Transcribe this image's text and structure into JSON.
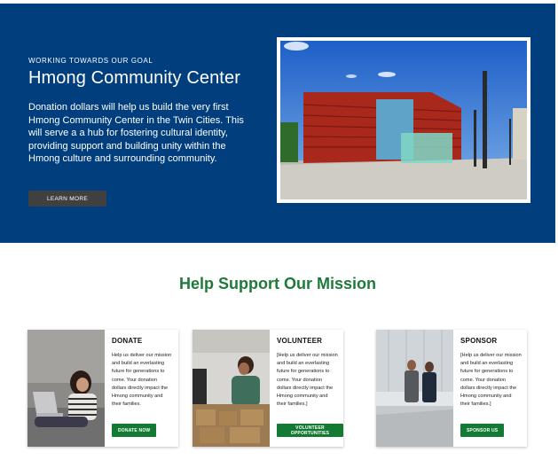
{
  "hero": {
    "eyebrow": "WORKING TOWARDS OUR GOAL",
    "title": "Hmong Community Center",
    "body": "Donation dollars will help us build the very first Hmong Community Center in the Twin Cities. This will serve a a hub for fostering cultural identity, providing support and building unity within the Hmong culture and surrounding community.",
    "button_label": "LEARN MORE"
  },
  "mission": {
    "title": "Help Support Our Mission"
  },
  "cards": [
    {
      "title": "DONATE",
      "text": "Help us deliver our mission and build an everlasting future for generations to come. Your donation dollars directly impact the Hmong community and their families.",
      "button_label": "DONATE NOW"
    },
    {
      "title": "VOLUNTEER",
      "text": "[Help us deliver our mission and build an everlasting future for generations to come. Your donation dollars directly impact the Hmong community and their families.]",
      "button_label": "VOLUNTEER OPPORTUNITIES"
    },
    {
      "title": "SPONSOR",
      "text": "[Help us deliver our mission and build an everlasting future for generations to come. Your donation dollars directly impact the Hmong community and their families.]",
      "button_label": "SPONSOR US"
    }
  ],
  "colors": {
    "hero_bg": "#003e7e",
    "accent_green": "#1f7a3a",
    "button_green": "#137a34",
    "button_dark": "#404040"
  }
}
